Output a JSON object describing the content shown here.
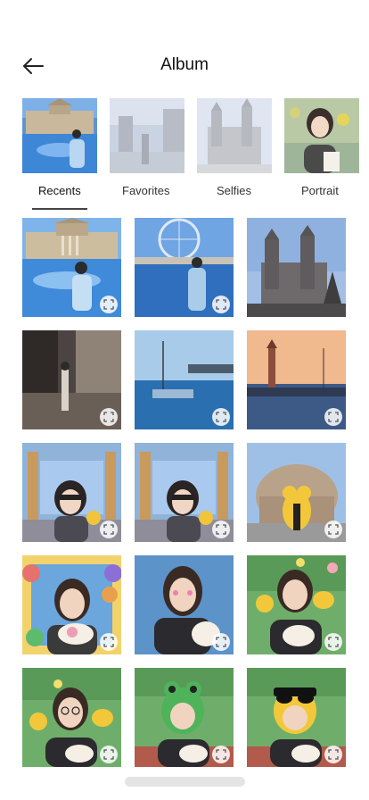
{
  "header": {
    "title": "Album"
  },
  "albums": [
    {
      "name": "recents-album-thumb"
    },
    {
      "name": "favorites-album-thumb"
    },
    {
      "name": "selfies-album-thumb"
    },
    {
      "name": "portrait-album-thumb"
    }
  ],
  "tabs": [
    "Recents",
    "Favorites",
    "Selfies",
    "Portrait"
  ],
  "active_tab": "Recents",
  "photos": [
    {
      "scene": "square-building-fountain-person"
    },
    {
      "scene": "ferris-wheel-river-person"
    },
    {
      "scene": "gothic-cathedral-sky"
    },
    {
      "scene": "street-night-person"
    },
    {
      "scene": "harbor-boat-dusk"
    },
    {
      "scene": "lighthouse-sunset-boats"
    },
    {
      "scene": "cathedral-interior-sticker-girl"
    },
    {
      "scene": "cathedral-interior-sticker-girl"
    },
    {
      "scene": "round-building-duck-sticker"
    },
    {
      "scene": "cartoon-frame-girl-bouquet"
    },
    {
      "scene": "blue-backdrop-graduation-girl"
    },
    {
      "scene": "stadium-stickers-girl"
    },
    {
      "scene": "stadium-stickers-girl-glasses"
    },
    {
      "scene": "stadium-frog-mask-girl"
    },
    {
      "scene": "stadium-duck-mask-girl"
    }
  ],
  "icons": {
    "back": "arrow-left-icon",
    "expand": "expand-icon"
  }
}
